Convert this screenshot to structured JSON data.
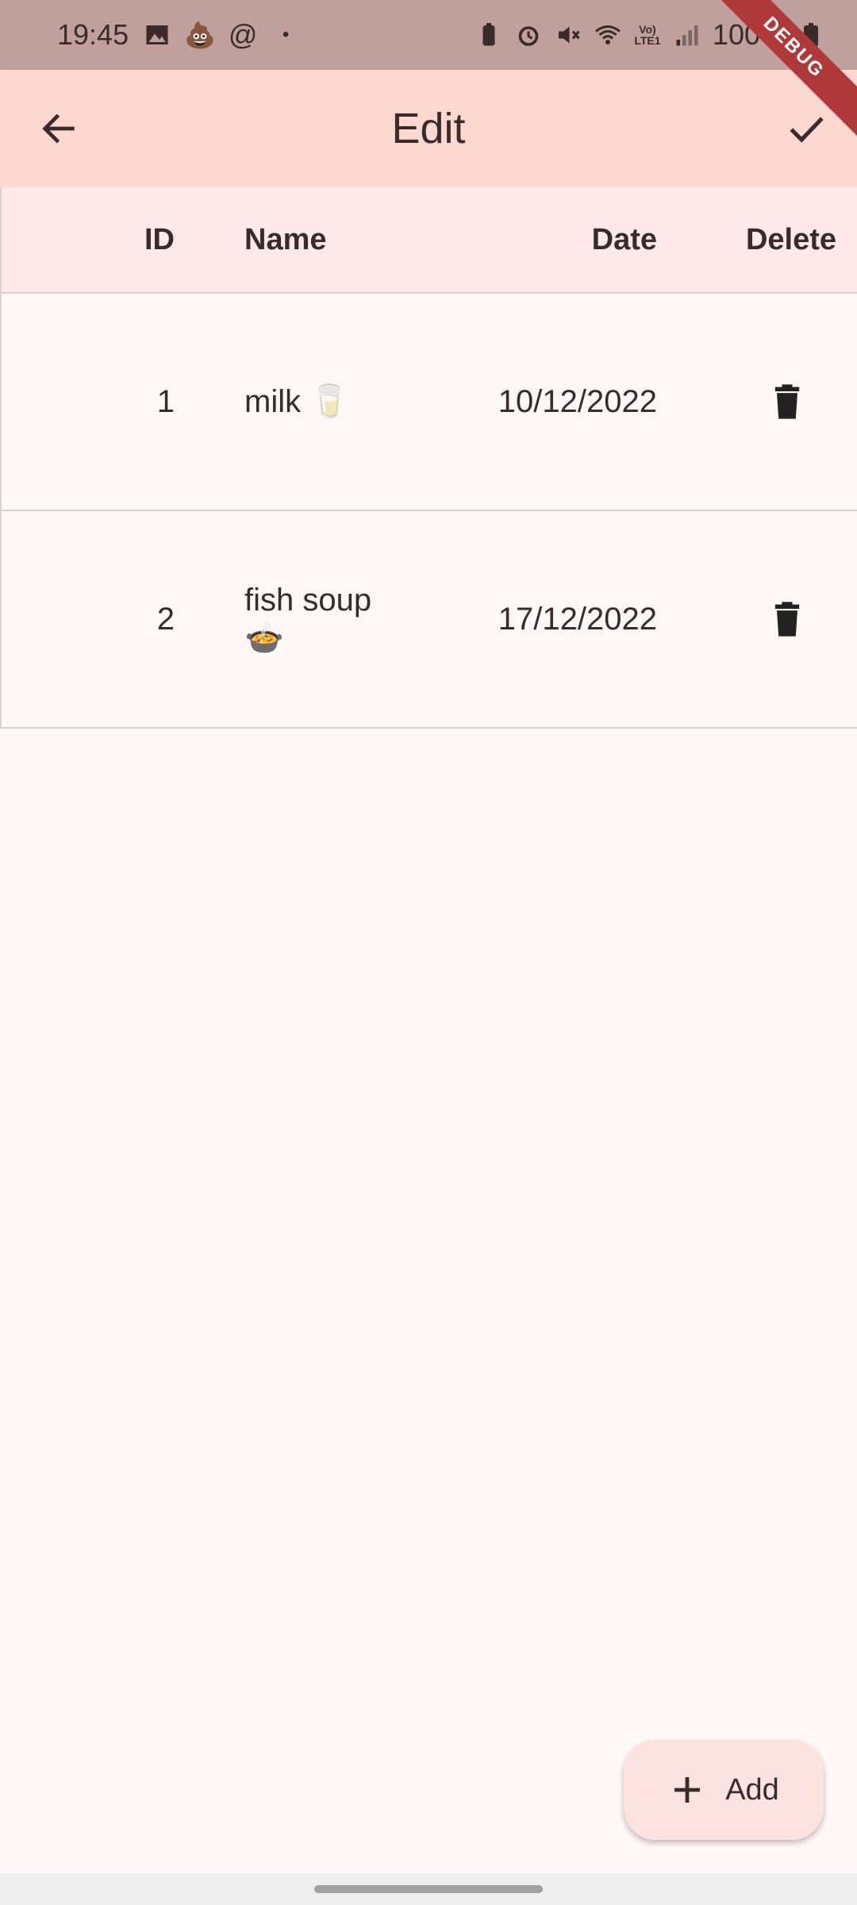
{
  "status_bar": {
    "time": "19:45",
    "left_icons": [
      "image-icon",
      "poop-emoji-icon",
      "at-icon",
      "dot-icon"
    ],
    "right_icons": [
      "battery-saver-icon",
      "alarm-icon",
      "mute-icon",
      "wifi-icon",
      "volte-icon",
      "signal-icon"
    ],
    "battery": "100%",
    "debug_label": "DEBUG"
  },
  "app_bar": {
    "title": "Edit",
    "back_icon": "arrow-back-icon",
    "confirm_icon": "check-icon"
  },
  "table": {
    "columns": [
      "ID",
      "Name",
      "Date",
      "Delete"
    ],
    "rows": [
      {
        "id": "1",
        "name": "milk 🥛",
        "date": "10/12/2022"
      },
      {
        "id": "2",
        "name": "fish soup 🍲",
        "date": "17/12/2022"
      }
    ]
  },
  "fab": {
    "label": "Add",
    "icon": "plus-icon"
  },
  "colors": {
    "status_bar": "#c0a09c",
    "app_bar": "#fdd8d0",
    "header_row": "#fde9e7",
    "background": "#fff8f6",
    "fab": "#fde3e0",
    "text": "#3a2b2a"
  }
}
